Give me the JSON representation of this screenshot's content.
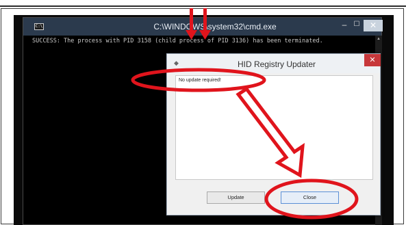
{
  "cmd_window": {
    "title": "C:\\WINDOWS\\system32\\cmd.exe",
    "icon": "cmd-prompt-icon",
    "minimize_label": "–",
    "maximize_label": "☐",
    "close_label": "✕",
    "output": "SUCCESS: The process with PID 3158 (child process of PID 3136) has been terminated."
  },
  "dialog": {
    "title": "HID Registry Updater",
    "icon": "app-icon",
    "close_label": "✕",
    "message": "No update required!",
    "update_label": "Update",
    "close_button_label": "Close"
  },
  "annotation_colors": {
    "highlight": "#e0141c"
  }
}
